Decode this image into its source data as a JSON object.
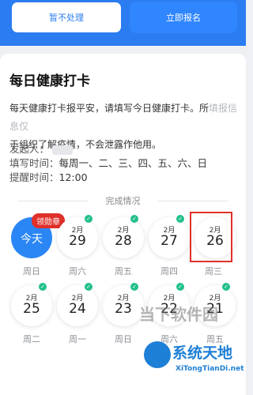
{
  "top_buttons": {
    "left_label": "暂不处理",
    "right_label": "立即报名"
  },
  "card": {
    "title": "每日健康打卡",
    "desc_main": "每天健康打卡报平安，请填写今日健康打卡。所",
    "desc_blur": "填报信息仅",
    "desc_line2": "于组织了解疫情，不会泄露作他用。",
    "initiator_label": "发起人：",
    "fill_time_label": "填写时间：",
    "fill_time_value": "每周一、二、三、四、五、六、日",
    "remind_label": "提醒时间：",
    "remind_value": "12:00",
    "section_title": "完成情况"
  },
  "calendar": {
    "row1": [
      {
        "today": true,
        "label": "今天",
        "badge": "领勋章",
        "weekday": "周日"
      },
      {
        "month": "2月",
        "day": "29",
        "weekday": "周六",
        "done": true
      },
      {
        "month": "2月",
        "day": "28",
        "weekday": "周五",
        "done": true
      },
      {
        "month": "2月",
        "day": "27",
        "weekday": "周四",
        "done": true
      },
      {
        "month": "2月",
        "day": "26",
        "weekday": "周三",
        "done": false,
        "selected": true
      }
    ],
    "row2": [
      {
        "month": "2月",
        "day": "25",
        "weekday": "周二",
        "done": true
      },
      {
        "month": "2月",
        "day": "24",
        "weekday": "周一",
        "done": true
      },
      {
        "month": "2月",
        "day": "23",
        "weekday": "周日",
        "done": true
      },
      {
        "month": "2月",
        "day": "22",
        "weekday": "周六",
        "done": true
      },
      {
        "month": "2月",
        "day": "21",
        "weekday": "周五",
        "done": true
      }
    ]
  },
  "watermarks": {
    "w1": "当下软件园",
    "w2": "系统天地",
    "w3": "XiTongTianDi.net"
  },
  "colors": {
    "primary": "#2b86f5",
    "check": "#22c08a",
    "badge": "#e0302a"
  }
}
